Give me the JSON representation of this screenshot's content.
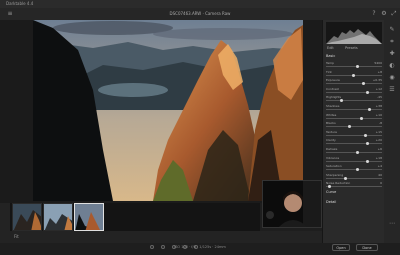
{
  "window": {
    "title": "Darktable 4.4"
  },
  "toolbar": {
    "doc_title": "DSC07463.ARW · Camera Raw"
  },
  "panel": {
    "tabs": [
      "Edit",
      "Presets"
    ],
    "sections": [
      {
        "name": "Basic"
      },
      {
        "name": "Curve"
      },
      {
        "name": "Detail"
      }
    ],
    "sliders": [
      {
        "label": "Temp",
        "value": "5400"
      },
      {
        "label": "Tint",
        "value": "+8"
      },
      {
        "label": "Exposure",
        "value": "+0.35"
      },
      {
        "label": "Contrast",
        "value": "+12"
      },
      {
        "label": "Highlights",
        "value": "-45"
      },
      {
        "label": "Shadows",
        "value": "+38"
      },
      {
        "label": "Whites",
        "value": "+10"
      },
      {
        "label": "Blacks",
        "value": "-8"
      },
      {
        "label": "Texture",
        "value": "+15"
      },
      {
        "label": "Clarity",
        "value": "+20"
      },
      {
        "label": "Dehaze",
        "value": "+6"
      },
      {
        "label": "Vibrance",
        "value": "+18"
      },
      {
        "label": "Saturation",
        "value": "+4"
      },
      {
        "label": "Sharpening",
        "value": "40"
      },
      {
        "label": "Noise Reduction",
        "value": "0"
      }
    ]
  },
  "status": {
    "zoom": "Fit",
    "info": "ISO 100 · f/8 · 1/125s · 24mm",
    "open_label": "Open",
    "done_label": "Done"
  },
  "colors": {
    "accent": "#d8d8d8",
    "background": "#1e1e1e",
    "panel": "#2a2a2a"
  }
}
